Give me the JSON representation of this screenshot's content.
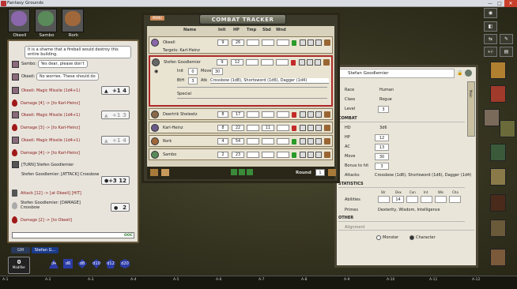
{
  "window": {
    "title": "Fantasy Grounds",
    "controls": [
      "—",
      "□",
      "✕"
    ]
  },
  "party": [
    {
      "name": "Okeeli",
      "color": "#8a66aa"
    },
    {
      "name": "Sambo",
      "color": "#5a8a5a"
    },
    {
      "name": "Rork",
      "color": "#a0683a"
    }
  ],
  "chat": {
    "messages": [
      {
        "type": "bubble",
        "text": "It is a shame that a fireball would destroy this entire building."
      },
      {
        "type": "speech",
        "speaker": "Sambo:",
        "text": "Yes dear, please don't"
      },
      {
        "type": "speech",
        "speaker": "Okeeli:",
        "text": "No worries. These should do"
      },
      {
        "type": "roll",
        "text": "Okeeli: Magic Missile (1d4+1)",
        "mod": "+1",
        "total": "4",
        "dim": false
      },
      {
        "type": "damage",
        "text": "Damage [4] -> [to Karl-Heinz]"
      },
      {
        "type": "roll",
        "text": "Okeeli: Magic Missile (1d4+1)",
        "mod": "+1",
        "total": "3",
        "dim": true
      },
      {
        "type": "damage",
        "text": "Damage [3] -> [to Karl-Heinz]"
      },
      {
        "type": "roll",
        "text": "Okeeli: Magic Missile (1d4+1)",
        "mod": "+1",
        "total": "4",
        "dim": true
      },
      {
        "type": "damage",
        "text": "Damage [4] -> [to Karl-Heinz]"
      },
      {
        "type": "turn",
        "text": "[TURN] Stefen Goodlemier"
      },
      {
        "type": "plain",
        "text": "Stefen Goodlemier: [ATTACK] Crossbow",
        "mod": "+3",
        "total": "12",
        "dim": false
      },
      {
        "type": "attack",
        "text": "Attack [12] -> [at Okeeli] [HIT]"
      },
      {
        "type": "plain",
        "text": "Stefen Goodlemier: [DAMAGE] Crossbow",
        "mod": "",
        "total": "2",
        "dim": false
      },
      {
        "type": "damage",
        "text": "Damage [2] -> [to Okeeli]"
      }
    ],
    "ooc": "OOC"
  },
  "identity_tabs": [
    "GM",
    "Stefan G..."
  ],
  "modifier": {
    "value": "0",
    "label": "Modifier"
  },
  "dice": [
    "d4",
    "d6",
    "d8",
    "d10",
    "d12",
    "d20"
  ],
  "hotkeys": [
    "A-1",
    "A-2",
    "A-3",
    "A-4",
    "A-5",
    "A-6",
    "A-7",
    "A-8",
    "A-9",
    "A-10",
    "A-11",
    "A-12"
  ],
  "sidebar": {
    "buttons": [
      "◉",
      "◧",
      "⇆",
      "+/-",
      "✎",
      "▤"
    ]
  },
  "combat_tracker": {
    "title": "COMBAT TRACKER",
    "menu": "MENU",
    "headers": [
      "Name",
      "Init",
      "HP",
      "Tmp",
      "Sbd",
      "Wnd"
    ],
    "rows": [
      {
        "name": "Okeeli",
        "init": "9",
        "hp": "26",
        "sbd": "",
        "wnd": "",
        "color": "#8a66aa",
        "faction": "#2a9a2a",
        "targets": "Targets: Karl-Heinz"
      },
      {
        "name": "Stefen Goodlemier",
        "init": "9",
        "hp": "12",
        "sbd": "",
        "wnd": "",
        "color": "#666",
        "faction": "#c42a2a",
        "detail": {
          "init_label": "Init",
          "init": "0",
          "move_label": "Move",
          "move": "30",
          "bth_label": "BtH",
          "bth": "3",
          "atk_label": "Atk",
          "atk": "Crossbow (1d8), Shortsword (1d6), Dagger (1d4)",
          "special_label": "Special"
        }
      },
      {
        "name": "Deertrik Sheleetz",
        "init": "8",
        "hp": "17",
        "sbd": "",
        "wnd": "",
        "color": "#8a6a4a",
        "faction": "#c42a2a"
      },
      {
        "name": "Karl-Heinz",
        "init": "8",
        "hp": "22",
        "sbd": "11",
        "wnd": "",
        "color": "#6a5a8a",
        "faction": "#c42a2a"
      },
      {
        "name": "Rork",
        "init": "4",
        "hp": "54",
        "sbd": "",
        "wnd": "",
        "color": "#a0683a",
        "faction": "#2a9a2a"
      },
      {
        "name": "Sambo",
        "init": "2",
        "hp": "23",
        "sbd": "",
        "wnd": "",
        "color": "#5a8a5a",
        "faction": "#2a9a2a"
      }
    ],
    "round_label": "Round",
    "round": "1"
  },
  "character_sheet": {
    "name": "Stefan Goodlemier",
    "fields": [
      {
        "label": "Race",
        "value": "Human"
      },
      {
        "label": "Class",
        "value": "Rogue"
      },
      {
        "label": "Level",
        "value": "3"
      }
    ],
    "combat_title": "COMBAT",
    "combat": [
      {
        "label": "HD",
        "value": "3d6"
      },
      {
        "label": "HP",
        "value": "12"
      },
      {
        "label": "AC",
        "value": "13"
      },
      {
        "label": "Move",
        "value": "30"
      },
      {
        "label": "Bonus to hit",
        "value": "3"
      },
      {
        "label": "Attacks",
        "value": "Crossbow (1d8), Shortsword (1d6), Dagger (1d4)"
      }
    ],
    "stats_title": "STATISTICS",
    "ability_headers": [
      "Str",
      "Dex",
      "Con",
      "Int",
      "Wis",
      "Cha"
    ],
    "abilities_label": "Abilities",
    "abilities": [
      "",
      "14",
      "",
      "",
      "",
      ""
    ],
    "primes_label": "Primes",
    "primes": "Dexterity, Wisdom, Intelligence",
    "other_title": "OTHER",
    "other_first": "Alignment",
    "monster_label": "Monster",
    "character_label": "Character",
    "tab_label": "Main"
  }
}
